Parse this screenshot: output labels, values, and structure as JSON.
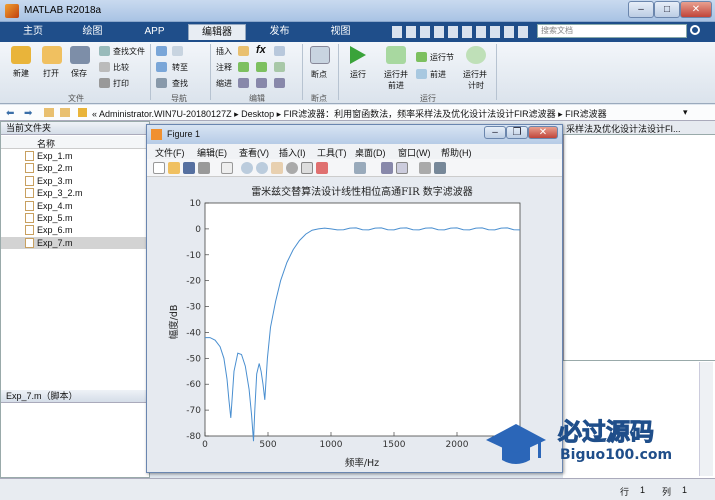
{
  "app": {
    "title": "MATLAB R2018a"
  },
  "ribbon_tabs": [
    {
      "label": "主页"
    },
    {
      "label": "绘图"
    },
    {
      "label": "APP"
    },
    {
      "label": "编辑器"
    },
    {
      "label": "发布"
    },
    {
      "label": "视图"
    }
  ],
  "search": {
    "placeholder": "搜索文档"
  },
  "toolstrip": {
    "new": "新建",
    "open": "打开",
    "save": "保存",
    "find_files": "查找文件",
    "compare": "比较",
    "print": "打印",
    "goto": "转至",
    "find": "查找",
    "insert": "插入",
    "comment": "注释",
    "indent": "缩进",
    "breakpoints": "断点",
    "run": "运行",
    "run_advance_1": "运行并",
    "run_advance_2": "前进",
    "run_section": "运行节",
    "advance": "前进",
    "run_time_1": "运行并",
    "run_time_2": "计时",
    "groups": {
      "file": "文件",
      "navigate": "导航",
      "edit": "编辑",
      "breakpoints": "断点",
      "run": "运行"
    }
  },
  "address": {
    "path": "« Administrator.WIN7U-20180127Z ▸ Desktop ▸ FIR滤波器：利用窗函数法，频率采样法及优化设计法设计FIR滤波器 ▸ FIR滤波器"
  },
  "current_folder": {
    "title": "当前文件夹",
    "column": "名称",
    "files": [
      "Exp_1.m",
      "Exp_2.m",
      "Exp_3.m",
      "Exp_3_2.m",
      "Exp_4.m",
      "Exp_5.m",
      "Exp_6.m",
      "Exp_7.m"
    ],
    "details": "Exp_7.m（脚本）"
  },
  "editor_tab": {
    "label": "采样法及优化设计法设计FI..."
  },
  "figure": {
    "title": "Figure 1",
    "menus": [
      "文件(F)",
      "编辑(E)",
      "查看(V)",
      "插入(I)",
      "工具(T)",
      "桌面(D)",
      "窗口(W)",
      "帮助(H)"
    ]
  },
  "chart_data": {
    "type": "line",
    "title": "雷米兹交替算法设计线性相位高通FIR 数字滤波器",
    "xlabel": "频率/Hz",
    "ylabel": "幅度/dB",
    "xlim": [
      0,
      2500
    ],
    "ylim": [
      -80,
      10
    ],
    "xticks": [
      0,
      500,
      1000,
      1500,
      2000
    ],
    "yticks": [
      10,
      0,
      -10,
      -20,
      -30,
      -40,
      -50,
      -60,
      -70,
      -80
    ],
    "grid": false,
    "color": "#4a8fd0",
    "series": [
      {
        "x": [
          0,
          40,
          80,
          120,
          150,
          175,
          190,
          205,
          230,
          260,
          290,
          320,
          350,
          370,
          385,
          395,
          410,
          430,
          445,
          460,
          475,
          485,
          495,
          520,
          560,
          600,
          650,
          700,
          750,
          800,
          850,
          900,
          950,
          1000,
          1050,
          1100,
          1150,
          1200,
          1250,
          1300,
          1350,
          1400,
          1450,
          1500,
          1550,
          1600,
          1650,
          1700,
          1750,
          1800,
          1850,
          1900,
          1950,
          2000,
          2050,
          2100,
          2150,
          2200,
          2250,
          2300,
          2350,
          2400,
          2450,
          2500
        ],
        "y": [
          -42,
          -42,
          -43,
          -45.5,
          -50,
          -58,
          -66,
          -73,
          -55,
          -48,
          -48.5,
          -53,
          -62,
          -72,
          -82,
          -70,
          -56,
          -52,
          -55,
          -60,
          -66,
          -58,
          -50,
          -38,
          -28,
          -20,
          -13,
          -8,
          -4.5,
          -2,
          -0.5,
          0,
          0.3,
          0,
          -0.4,
          -0.3,
          0.3,
          0.4,
          -0.3,
          -0.4,
          0.3,
          0.4,
          -0.3,
          -0.4,
          0.3,
          0.4,
          -0.3,
          -0.4,
          0.3,
          0.4,
          -0.3,
          -0.4,
          0.3,
          0.4,
          -0.3,
          -0.4,
          0.3,
          0.4,
          -0.3,
          -0.4,
          0.3,
          0.4,
          -0.3,
          -0.4
        ]
      }
    ]
  },
  "statusbar": {
    "row_label": "行",
    "row": "1",
    "col_label": "列",
    "col": "1"
  }
}
